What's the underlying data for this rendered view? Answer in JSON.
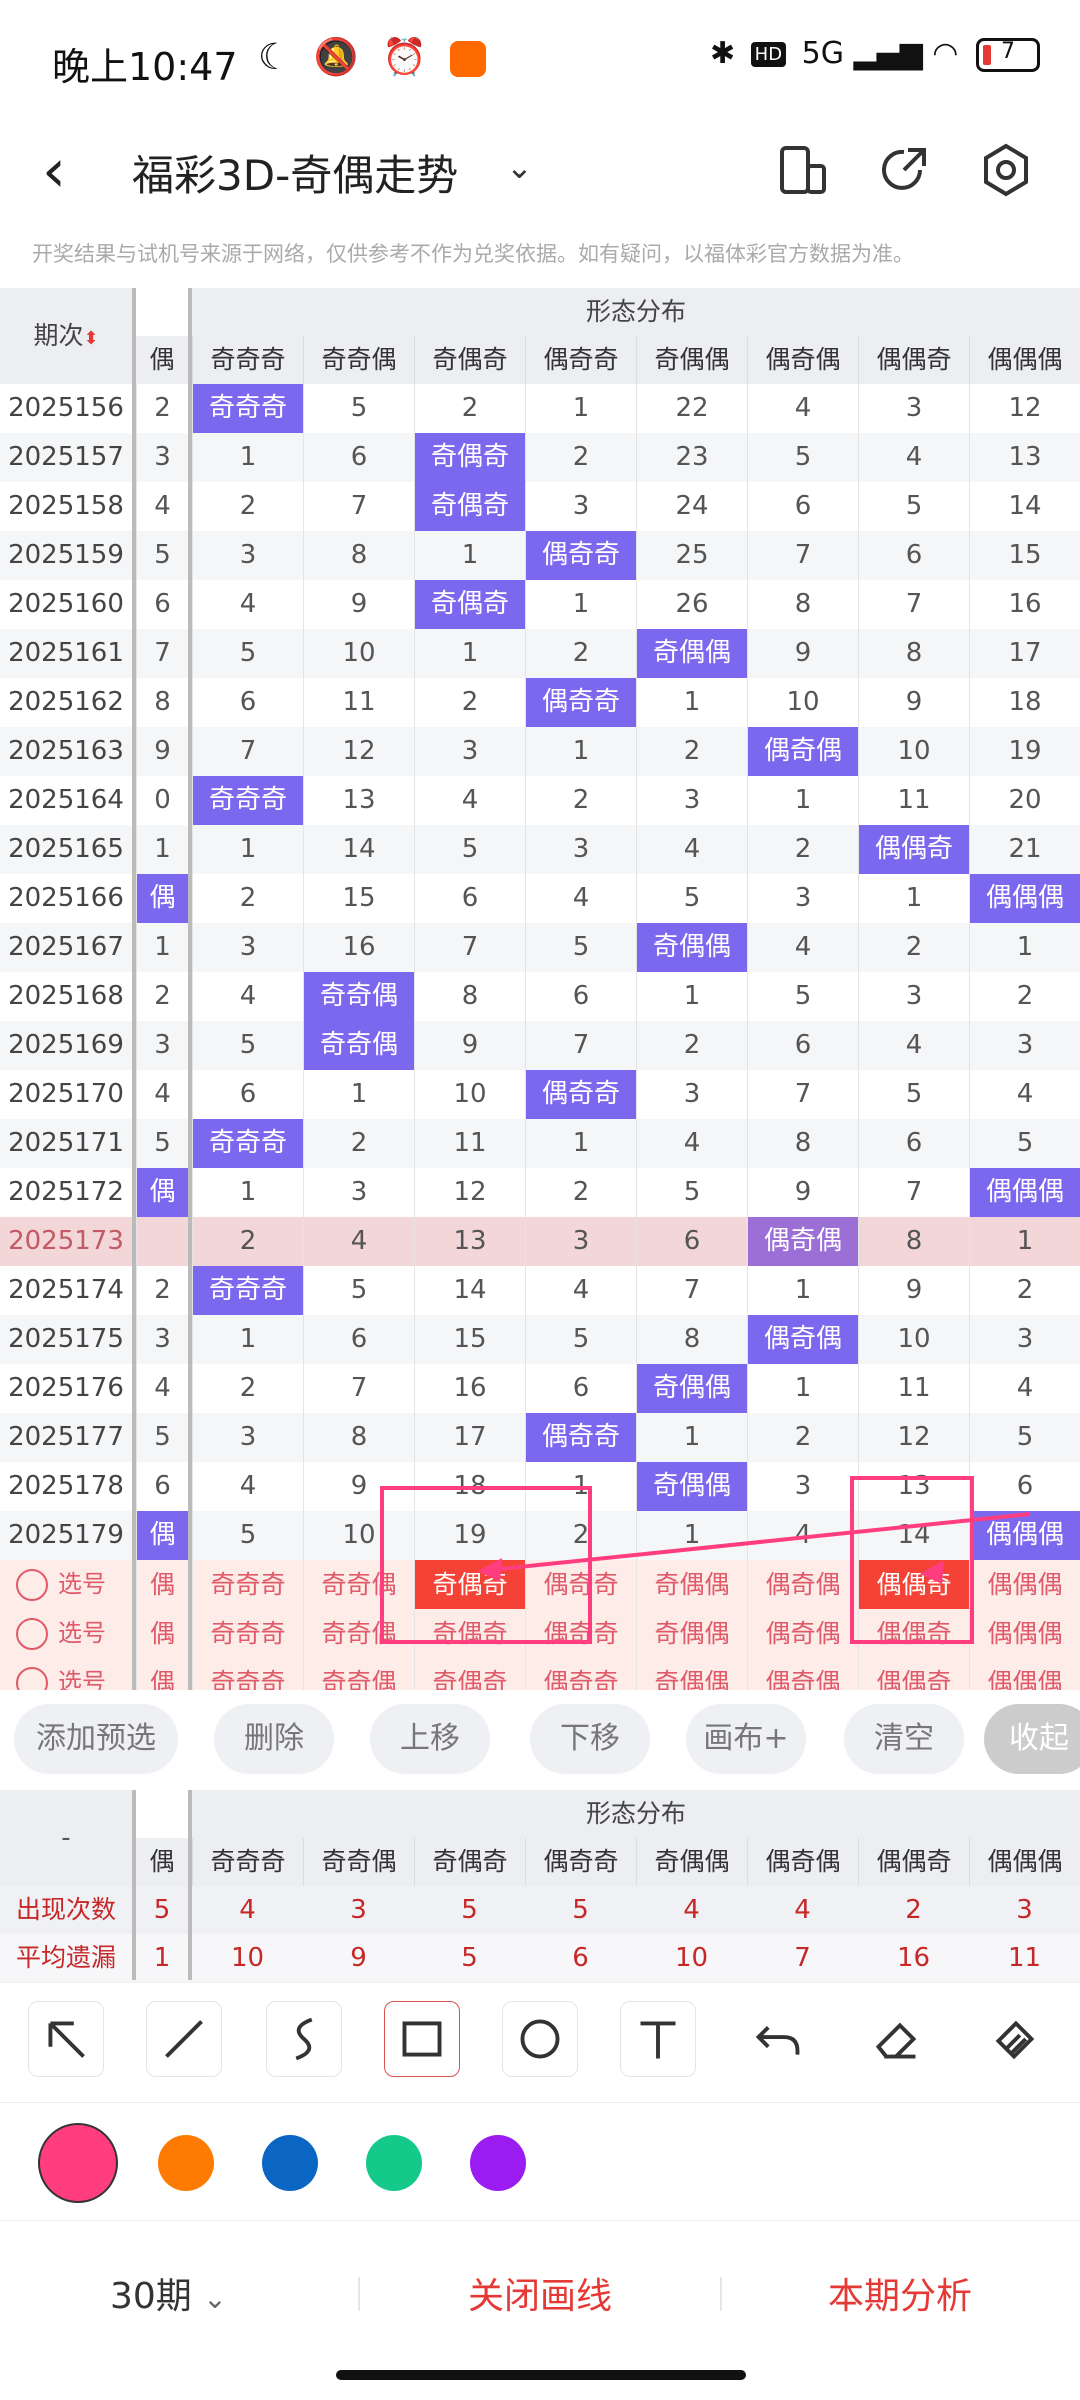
{
  "status": {
    "time": "晚上10:47",
    "hd": "HD",
    "network": "5G",
    "battery": "7"
  },
  "title": {
    "text": "福彩3D-奇偶走势"
  },
  "disclaimer": "开奖结果与试机号来源于网络，仅供参考不作为兑奖依据。如有疑问，以福体彩官方数据为准。",
  "table": {
    "period_header": "期次",
    "group_header": "形态分布",
    "prev_col_header": "偶",
    "columns": [
      "奇奇奇",
      "奇奇偶",
      "奇偶奇",
      "偶奇奇",
      "奇偶偶",
      "偶奇偶",
      "偶偶奇",
      "偶偶偶"
    ],
    "rows": [
      {
        "period": "2025156",
        "prev": "2",
        "v": [
          "奇奇奇",
          "5",
          "2",
          "1",
          "22",
          "4",
          "3",
          "12"
        ],
        "hit": 0
      },
      {
        "period": "2025157",
        "prev": "3",
        "v": [
          "1",
          "6",
          "奇偶奇",
          "2",
          "23",
          "5",
          "4",
          "13"
        ],
        "hit": 2
      },
      {
        "period": "2025158",
        "prev": "4",
        "v": [
          "2",
          "7",
          "奇偶奇",
          "3",
          "24",
          "6",
          "5",
          "14"
        ],
        "hit": 2
      },
      {
        "period": "2025159",
        "prev": "5",
        "v": [
          "3",
          "8",
          "1",
          "偶奇奇",
          "25",
          "7",
          "6",
          "15"
        ],
        "hit": 3
      },
      {
        "period": "2025160",
        "prev": "6",
        "v": [
          "4",
          "9",
          "奇偶奇",
          "1",
          "26",
          "8",
          "7",
          "16"
        ],
        "hit": 2
      },
      {
        "period": "2025161",
        "prev": "7",
        "v": [
          "5",
          "10",
          "1",
          "2",
          "奇偶偶",
          "9",
          "8",
          "17"
        ],
        "hit": 4
      },
      {
        "period": "2025162",
        "prev": "8",
        "v": [
          "6",
          "11",
          "2",
          "偶奇奇",
          "1",
          "10",
          "9",
          "18"
        ],
        "hit": 3
      },
      {
        "period": "2025163",
        "prev": "9",
        "v": [
          "7",
          "12",
          "3",
          "1",
          "2",
          "偶奇偶",
          "10",
          "19"
        ],
        "hit": 5
      },
      {
        "period": "2025164",
        "prev": "0",
        "v": [
          "奇奇奇",
          "13",
          "4",
          "2",
          "3",
          "1",
          "11",
          "20"
        ],
        "hit": 0
      },
      {
        "period": "2025165",
        "prev": "1",
        "v": [
          "1",
          "14",
          "5",
          "3",
          "4",
          "2",
          "偶偶奇",
          "21"
        ],
        "hit": 6
      },
      {
        "period": "2025166",
        "prev": "偶",
        "v": [
          "2",
          "15",
          "6",
          "4",
          "5",
          "3",
          "1",
          "偶偶偶"
        ],
        "hit": 7
      },
      {
        "period": "2025167",
        "prev": "1",
        "v": [
          "3",
          "16",
          "7",
          "5",
          "奇偶偶",
          "4",
          "2",
          "1"
        ],
        "hit": 4
      },
      {
        "period": "2025168",
        "prev": "2",
        "v": [
          "4",
          "奇奇偶",
          "8",
          "6",
          "1",
          "5",
          "3",
          "2"
        ],
        "hit": 1
      },
      {
        "period": "2025169",
        "prev": "3",
        "v": [
          "5",
          "奇奇偶",
          "9",
          "7",
          "2",
          "6",
          "4",
          "3"
        ],
        "hit": 1
      },
      {
        "period": "2025170",
        "prev": "4",
        "v": [
          "6",
          "1",
          "10",
          "偶奇奇",
          "3",
          "7",
          "5",
          "4"
        ],
        "hit": 3
      },
      {
        "period": "2025171",
        "prev": "5",
        "v": [
          "奇奇奇",
          "2",
          "11",
          "1",
          "4",
          "8",
          "6",
          "5"
        ],
        "hit": 0
      },
      {
        "period": "2025172",
        "prev": "偶",
        "v": [
          "1",
          "3",
          "12",
          "2",
          "5",
          "9",
          "7",
          "偶偶偶"
        ],
        "hit": 7
      },
      {
        "period": "2025173",
        "prev": "",
        "v": [
          "2",
          "4",
          "13",
          "3",
          "6",
          "偶奇偶",
          "8",
          "1"
        ],
        "hit": 5,
        "highlight": true
      },
      {
        "period": "2025174",
        "prev": "2",
        "v": [
          "奇奇奇",
          "5",
          "14",
          "4",
          "7",
          "1",
          "9",
          "2"
        ],
        "hit": 0
      },
      {
        "period": "2025175",
        "prev": "3",
        "v": [
          "1",
          "6",
          "15",
          "5",
          "8",
          "偶奇偶",
          "10",
          "3"
        ],
        "hit": 5
      },
      {
        "period": "2025176",
        "prev": "4",
        "v": [
          "2",
          "7",
          "16",
          "6",
          "奇偶偶",
          "1",
          "11",
          "4"
        ],
        "hit": 4
      },
      {
        "period": "2025177",
        "prev": "5",
        "v": [
          "3",
          "8",
          "17",
          "偶奇奇",
          "1",
          "2",
          "12",
          "5"
        ],
        "hit": 3
      },
      {
        "period": "2025178",
        "prev": "6",
        "v": [
          "4",
          "9",
          "18",
          "1",
          "奇偶偶",
          "3",
          "13",
          "6"
        ],
        "hit": 4
      },
      {
        "period": "2025179",
        "prev": "偶",
        "v": [
          "5",
          "10",
          "19",
          "2",
          "1",
          "4",
          "14",
          "偶偶偶"
        ],
        "hit": 7
      }
    ],
    "select_label": "选号",
    "select_rows": [
      {
        "prev": "偶",
        "v": [
          "奇奇奇",
          "奇奇偶",
          "奇偶奇",
          "偶奇奇",
          "奇偶偶",
          "偶奇偶",
          "偶偶奇",
          "偶偶偶"
        ],
        "picked": [
          2,
          6
        ]
      },
      {
        "prev": "偶",
        "v": [
          "奇奇奇",
          "奇奇偶",
          "奇偶奇",
          "偶奇奇",
          "奇偶偶",
          "偶奇偶",
          "偶偶奇",
          "偶偶偶"
        ],
        "picked": []
      },
      {
        "prev": "偶",
        "v": [
          "奇奇奇",
          "奇奇偶",
          "奇偶奇",
          "偶奇奇",
          "奇偶偶",
          "偶奇偶",
          "偶偶奇",
          "偶偶偶"
        ],
        "picked": []
      }
    ]
  },
  "actions": {
    "add": "添加预选",
    "delete": "删除",
    "up": "上移",
    "down": "下移",
    "canvas": "画布+",
    "clear": "清空",
    "collapse": "收起"
  },
  "stats": {
    "corner": "-",
    "group_header": "形态分布",
    "prev_col_header": "偶",
    "columns": [
      "奇奇奇",
      "奇奇偶",
      "奇偶奇",
      "偶奇奇",
      "奇偶偶",
      "偶奇偶",
      "偶偶奇",
      "偶偶偶"
    ],
    "rows": [
      {
        "label": "出现次数",
        "prev": "5",
        "values": [
          "4",
          "3",
          "5",
          "5",
          "4",
          "4",
          "2",
          "3"
        ]
      },
      {
        "label": "平均遗漏",
        "prev": "1",
        "values": [
          "10",
          "9",
          "5",
          "6",
          "10",
          "7",
          "16",
          "11"
        ]
      }
    ]
  },
  "tools": [
    "arrow-icon",
    "line-icon",
    "curve-icon",
    "rectangle-icon",
    "circle-icon",
    "text-icon",
    "undo-icon",
    "eraser-icon",
    "clear-icon"
  ],
  "colors": [
    "#ff3d7f",
    "#ff7a00",
    "#0a66c2",
    "#14c98a",
    "#9b1cf0"
  ],
  "bottom": {
    "periods": "30期",
    "close_lines": "关闭画线",
    "analysis": "本期分析"
  }
}
